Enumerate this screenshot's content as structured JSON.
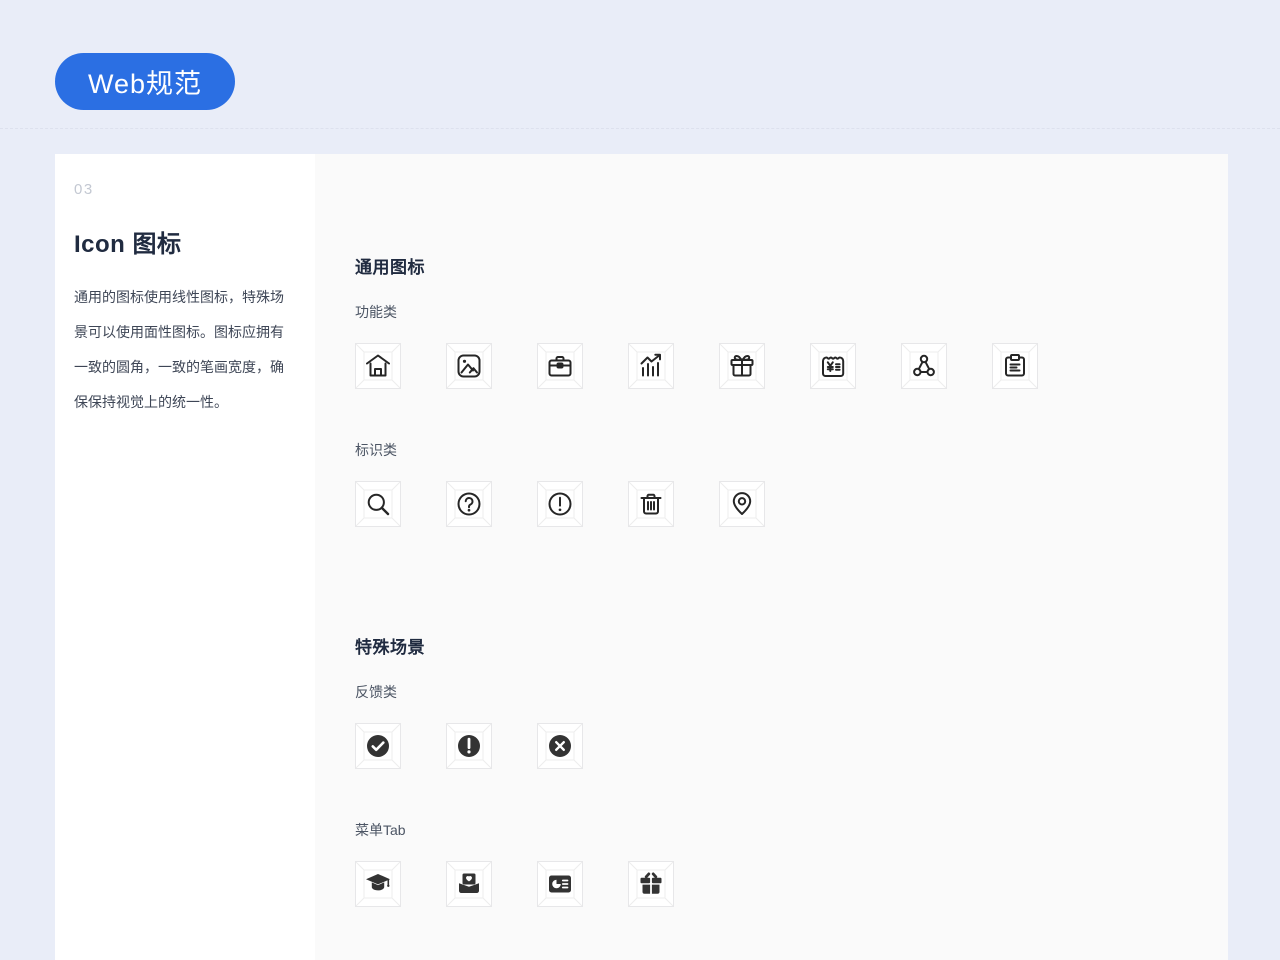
{
  "badge": {
    "label": "Web规范"
  },
  "panel": {
    "index": "03",
    "title": "Icon 图标",
    "description": "通用的图标使用线性图标，特殊场景可以使用面性图标。图标应拥有一致的圆角，一致的笔画宽度，确保保持视觉上的统一性。"
  },
  "sections": [
    {
      "title": "通用图标",
      "groups": [
        {
          "label": "功能类",
          "icons": [
            "home",
            "image",
            "briefcase",
            "chart",
            "gift",
            "bill",
            "share-network",
            "clipboard"
          ]
        },
        {
          "label": "标识类",
          "icons": [
            "search",
            "question-circle",
            "exclamation-circle",
            "trash",
            "location-pin"
          ]
        }
      ]
    },
    {
      "title": "特殊场景",
      "groups": [
        {
          "label": "反馈类",
          "icons": [
            "check-circle-filled",
            "exclamation-circle-filled",
            "close-circle-filled"
          ]
        },
        {
          "label": "菜单Tab",
          "icons": [
            "education-filled",
            "mail-heart-filled",
            "report-card-filled",
            "gift-filled"
          ]
        }
      ]
    }
  ],
  "colors": {
    "accent": "#2b6fe3",
    "page_background": "#e9edf8",
    "card_sidebar": "#ffffff",
    "card_main": "#fafafa",
    "icon_stroke": "#262626",
    "icon_fill_dark": "#333333",
    "keyline": "#ededed"
  }
}
